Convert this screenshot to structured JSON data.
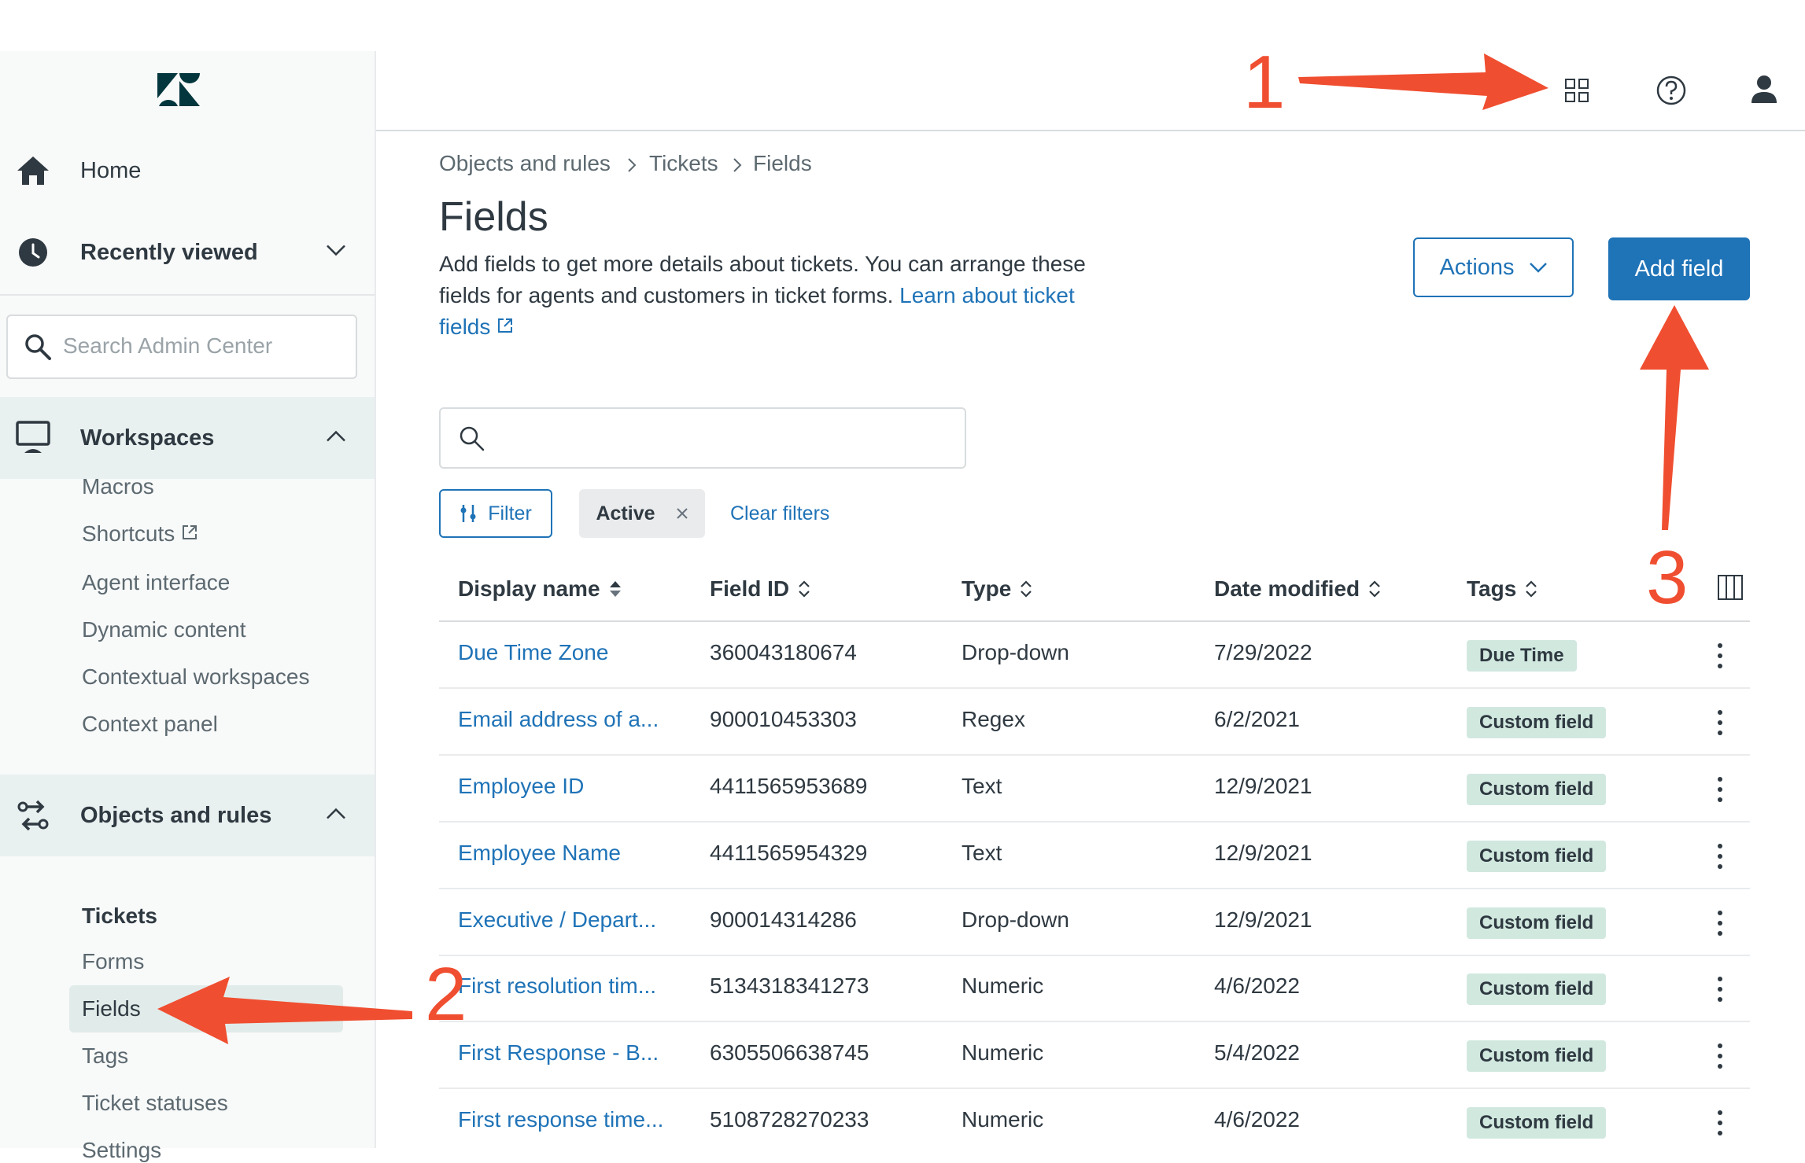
{
  "sidebar": {
    "home": "Home",
    "recently_viewed": "Recently viewed",
    "search_placeholder": "Search Admin Center",
    "workspaces": {
      "label": "Workspaces",
      "items": [
        "Macros",
        "Shortcuts",
        "Agent interface",
        "Dynamic content",
        "Contextual workspaces",
        "Context panel"
      ]
    },
    "objects_and_rules": {
      "label": "Objects and rules",
      "group": "Tickets",
      "items": [
        "Forms",
        "Fields",
        "Tags",
        "Ticket statuses",
        "Settings"
      ]
    }
  },
  "breadcrumb": [
    "Objects and rules",
    "Tickets",
    "Fields"
  ],
  "page": {
    "title": "Fields",
    "description": "Add fields to get more details about tickets. You can arrange these fields for agents and customers in ticket forms.",
    "learn_link": "Learn about ticket fields",
    "actions_label": "Actions",
    "add_field_label": "Add field",
    "search_placeholder": ""
  },
  "filters": {
    "filter_label": "Filter",
    "active_chip": "Active",
    "clear_label": "Clear filters"
  },
  "table": {
    "columns": [
      "Display name",
      "Field ID",
      "Type",
      "Date modified",
      "Tags"
    ],
    "rows": [
      {
        "name": "Due Time Zone",
        "id": "360043180674",
        "type": "Drop-down",
        "date": "7/29/2022",
        "tag": "Due Time"
      },
      {
        "name": "Email address of a...",
        "id": "900010453303",
        "type": "Regex",
        "date": "6/2/2021",
        "tag": "Custom field"
      },
      {
        "name": "Employee ID",
        "id": "4411565953689",
        "type": "Text",
        "date": "12/9/2021",
        "tag": "Custom field"
      },
      {
        "name": "Employee Name",
        "id": "4411565954329",
        "type": "Text",
        "date": "12/9/2021",
        "tag": "Custom field"
      },
      {
        "name": "Executive / Depart...",
        "id": "900014314286",
        "type": "Drop-down",
        "date": "12/9/2021",
        "tag": "Custom field"
      },
      {
        "name": "First resolution tim...",
        "id": "5134318341273",
        "type": "Numeric",
        "date": "4/6/2022",
        "tag": "Custom field"
      },
      {
        "name": "First Response - B...",
        "id": "6305506638745",
        "type": "Numeric",
        "date": "5/4/2022",
        "tag": "Custom field"
      },
      {
        "name": "First response time...",
        "id": "5108728270233",
        "type": "Numeric",
        "date": "4/6/2022",
        "tag": "Custom field"
      }
    ]
  },
  "annotations": [
    "1",
    "2",
    "3"
  ],
  "colors": {
    "accent": "#1f73b7",
    "annotation": "#f04e30",
    "tag_bg": "#d1e8df"
  },
  "icons": [
    "zendesk-logo",
    "home-icon",
    "clock-icon",
    "search-icon",
    "monitor-icon",
    "objects-rules-icon",
    "grid-apps-icon",
    "help-icon",
    "user-icon",
    "external-link-icon",
    "filter-icon",
    "sort-icon",
    "columns-icon",
    "kebab-icon"
  ]
}
